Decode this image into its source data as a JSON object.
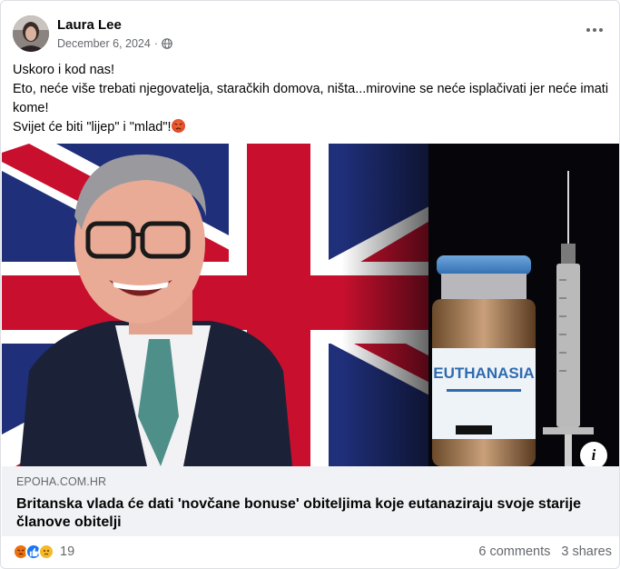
{
  "post": {
    "author": "Laura Lee",
    "date": "December 6, 2024",
    "separator": "·",
    "privacy_icon": "globe-icon",
    "lines": [
      "Uskoro i kod nas!",
      "Eto, neće više trebati njegovatelja, staračkih domova, ništa...mirovine se neće isplačivati jer neće imati kome!",
      "Svijet će biti \"lijep\" i \"mlad\"!"
    ]
  },
  "media": {
    "vial_label": "EUTHANASIA",
    "info_label": "i"
  },
  "link": {
    "domain": "EPOHA.COM.HR",
    "title": "Britanska vlada će dati 'novčane bonuse' obiteljima koje eutanaziraju svoje starije članove obitelji"
  },
  "footer": {
    "reaction_count": "19",
    "comments": "6 comments",
    "shares": "3 shares",
    "reaction_icons": [
      "angry-react-icon",
      "like-react-icon",
      "sad-react-icon"
    ]
  },
  "colors": {
    "text_primary": "#050505",
    "text_secondary": "#65676b",
    "link_bg": "#f0f2f5",
    "like_blue": "#1877f2",
    "angry_orange": "#e9710f",
    "sad_yellow": "#f7b928"
  }
}
